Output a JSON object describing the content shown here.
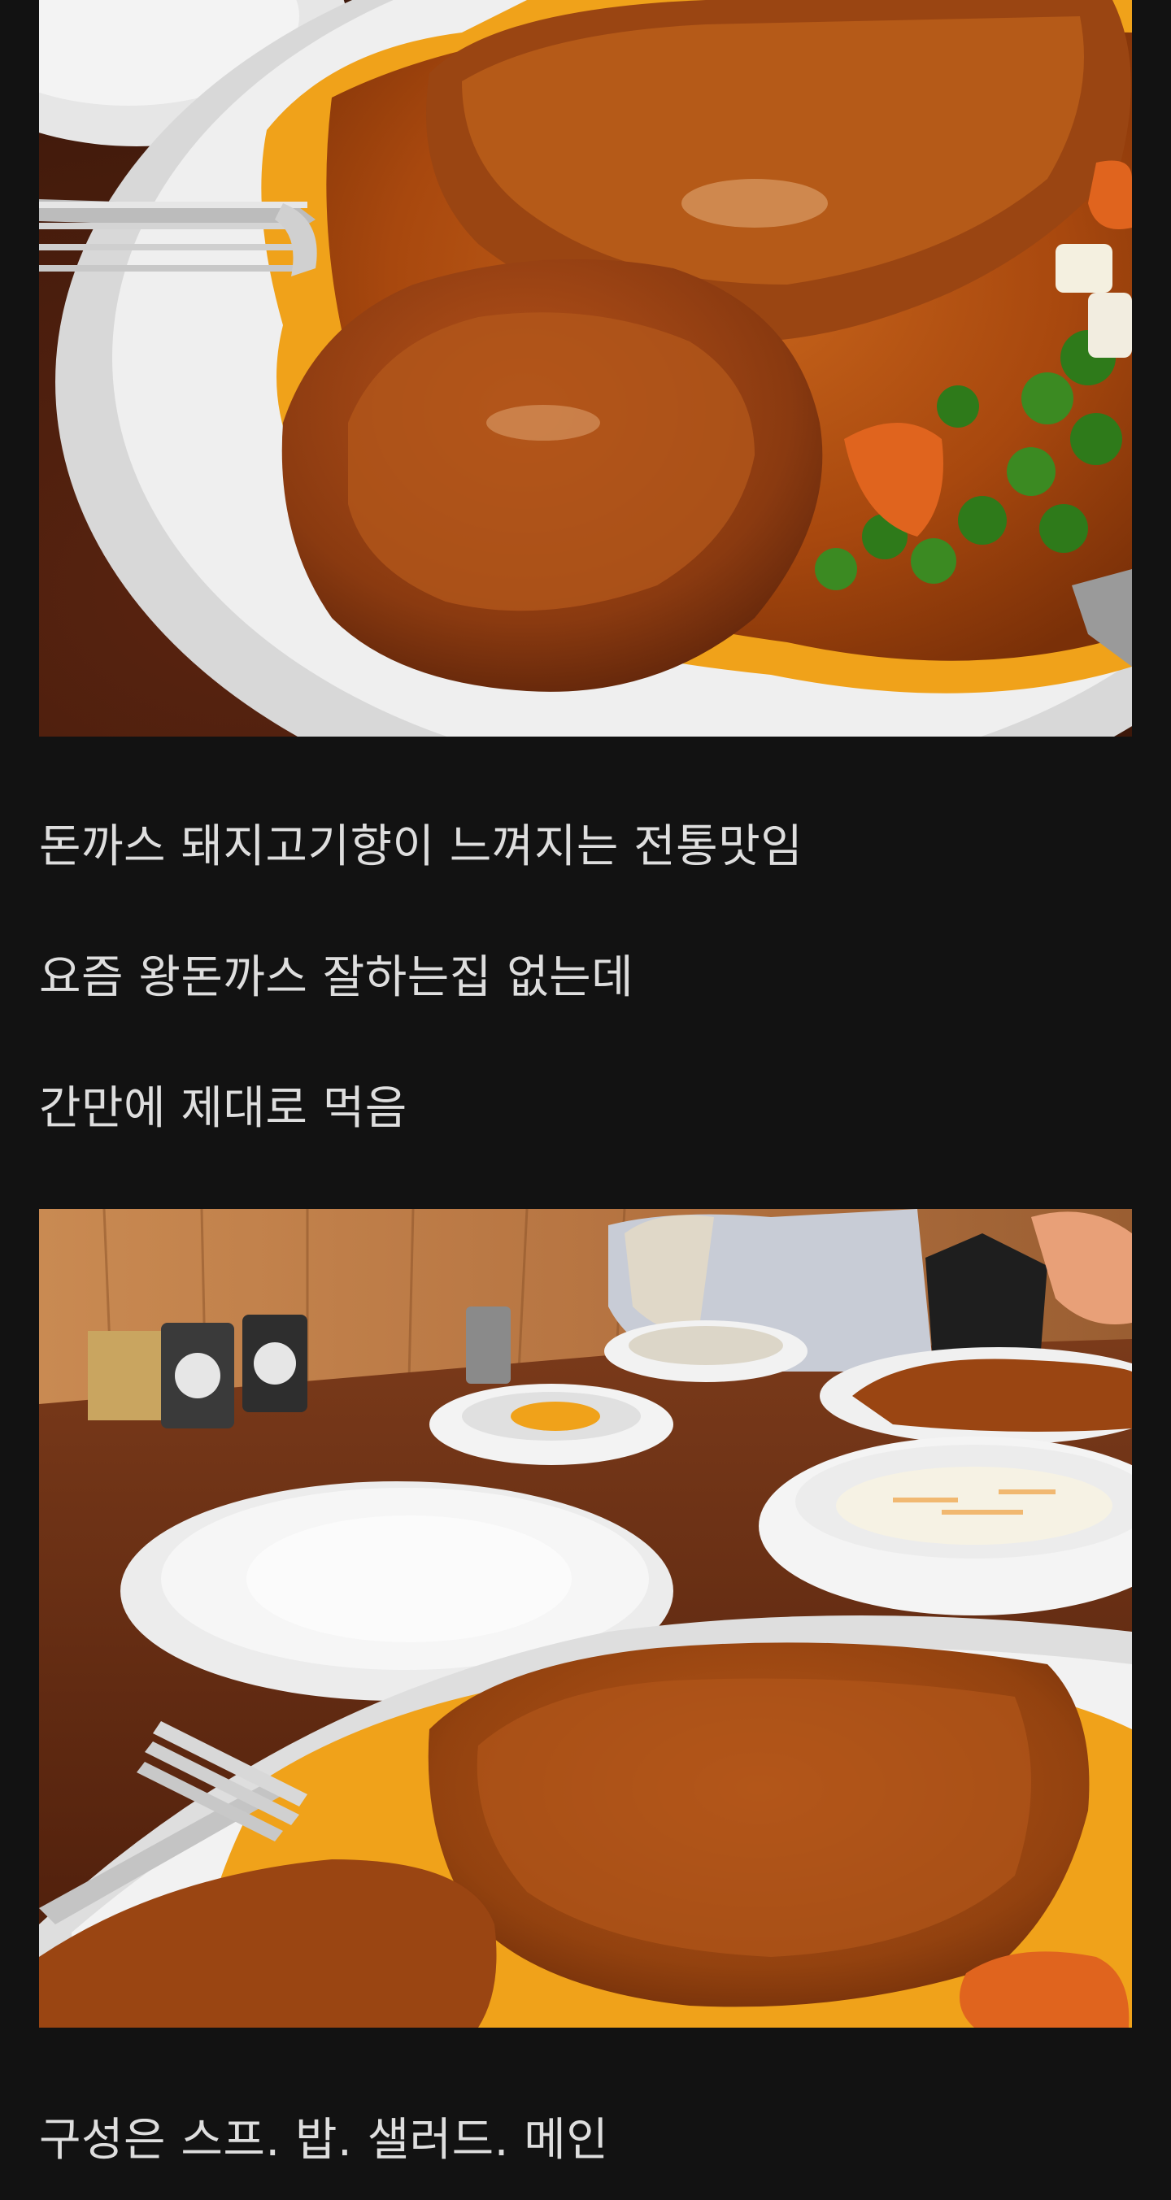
{
  "post": {
    "paragraphs": [
      "돈까스  돼지고기향이 느껴지는 전통맛임",
      "요즘 왕돈까스 잘하는집 없는데",
      "간만에 제대로 먹음",
      "구성은 스프. 밥. 샐러드. 메인"
    ],
    "images": [
      {
        "label": "pork cutlet with sauce, peas and carrots close-up"
      },
      {
        "label": "table with cutlet plate, rice, salad and soup bowls"
      }
    ]
  },
  "colors": {
    "background": "#121212",
    "text": "#dedede",
    "sauce": "#b8520f",
    "cutlet": "#8a3a10",
    "plate": "#ececec",
    "table": "#6b2f14"
  }
}
